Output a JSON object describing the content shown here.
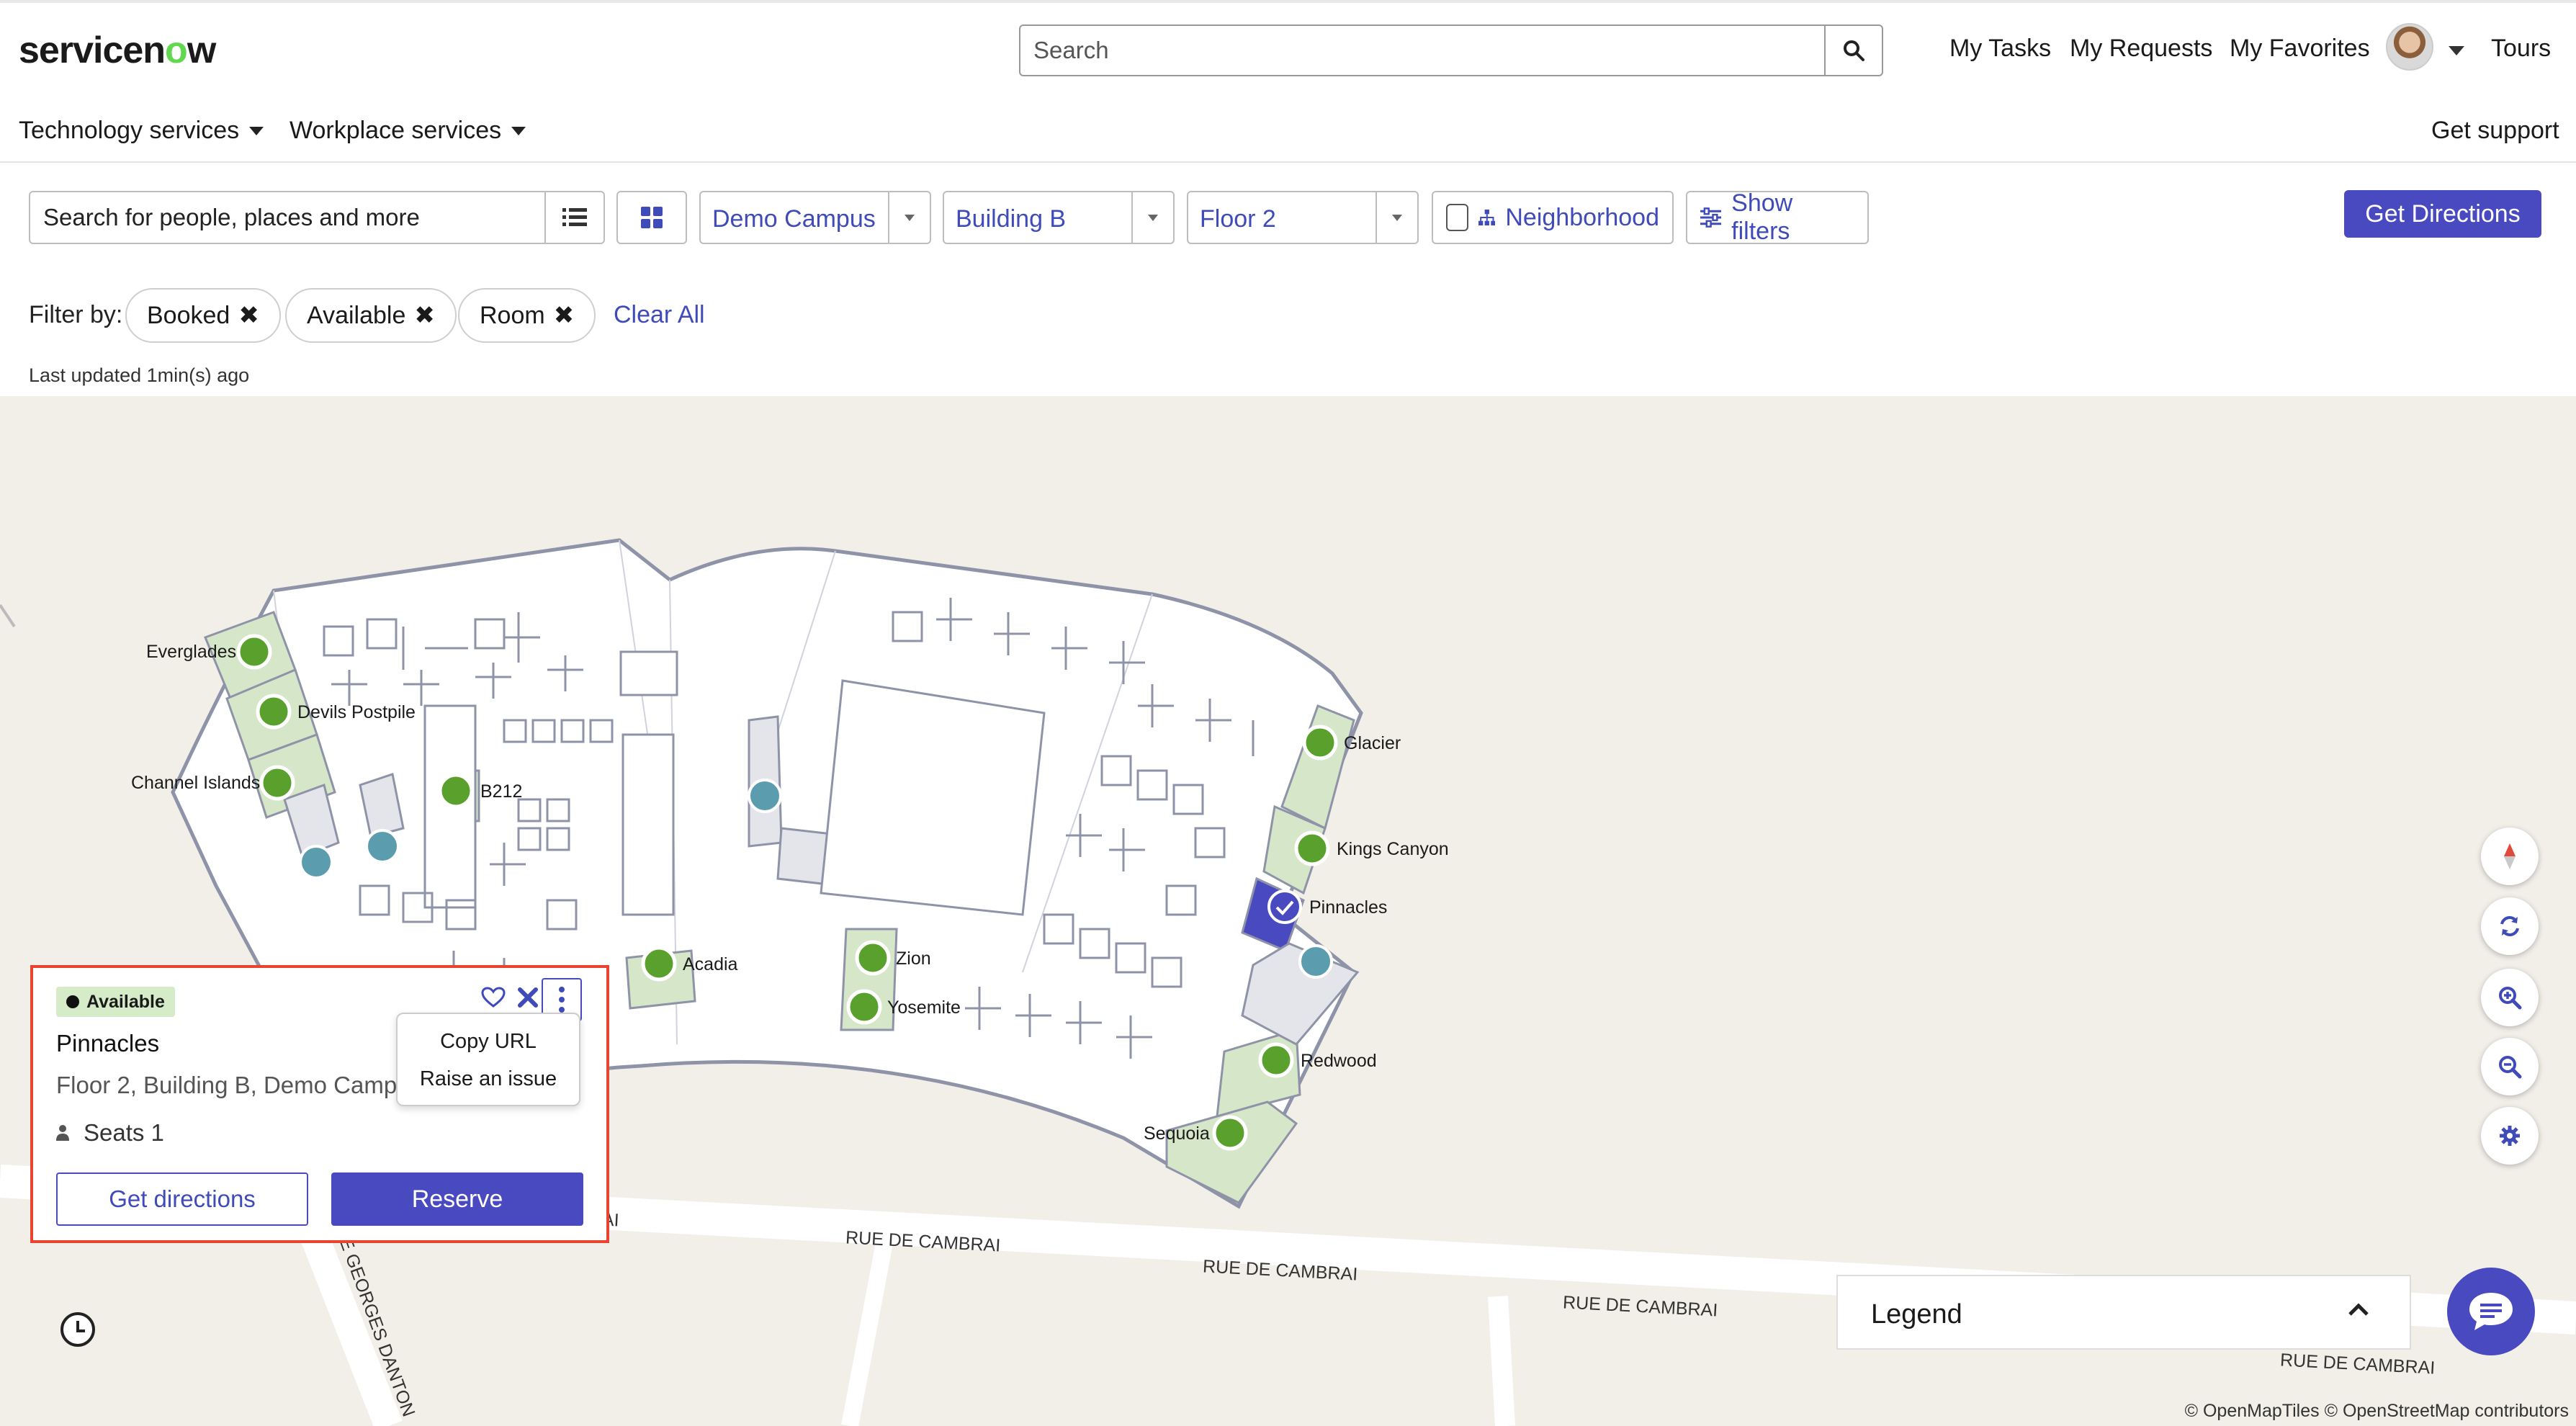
{
  "header": {
    "logo_text_a": "servicen",
    "logo_text_o": "o",
    "logo_text_b": "w",
    "search_placeholder": "Search",
    "links": [
      "My Tasks",
      "My Requests",
      "My Favorites"
    ],
    "tours_label": "Tours",
    "nav": [
      "Technology services",
      "Workplace services"
    ],
    "get_support": "Get support"
  },
  "toolbar": {
    "search_placeholder": "Search for people, places and more",
    "campus": "Demo Campus",
    "building": "Building B",
    "floor": "Floor 2",
    "neighborhood_label": "Neighborhood",
    "show_filters_label": "Show filters",
    "get_directions_label": "Get Directions",
    "filter_by_label": "Filter by:",
    "filters": [
      "Booked",
      "Available",
      "Room"
    ],
    "clear_all_label": "Clear All",
    "last_updated": "Last updated 1min(s) ago"
  },
  "map": {
    "rooms": [
      {
        "name": "Everglades"
      },
      {
        "name": "Devils Postpile"
      },
      {
        "name": "Channel Islands"
      },
      {
        "name": "B212"
      },
      {
        "name": "Acadia"
      },
      {
        "name": "Zion"
      },
      {
        "name": "Yosemite"
      },
      {
        "name": "Glacier"
      },
      {
        "name": "Kings Canyon"
      },
      {
        "name": "Pinnacles"
      },
      {
        "name": "Redwood"
      },
      {
        "name": "Sequoia"
      }
    ],
    "streets": [
      "RUE DE CAMBRAI",
      "RUE DE CAMBRAI",
      "RUE DE CAMBRAI",
      "RUE DE CAMBRAI",
      "UE GEORGES DANTON",
      "AI"
    ],
    "attribution": "© OpenMapTiles © OpenStreetMap contributors",
    "legend_label": "Legend",
    "colors": {
      "available": "#5aa02c",
      "room_fill": "#d6e6c9",
      "selected": "#4a4ac0",
      "accent": "#4a4ac0"
    }
  },
  "popup": {
    "status": "Available",
    "title": "Pinnacles",
    "location": "Floor 2, Building B, Demo Campus",
    "seats": "Seats 1",
    "get_directions_label": "Get directions",
    "reserve_label": "Reserve",
    "menu": [
      "Copy URL",
      "Raise an issue"
    ]
  }
}
